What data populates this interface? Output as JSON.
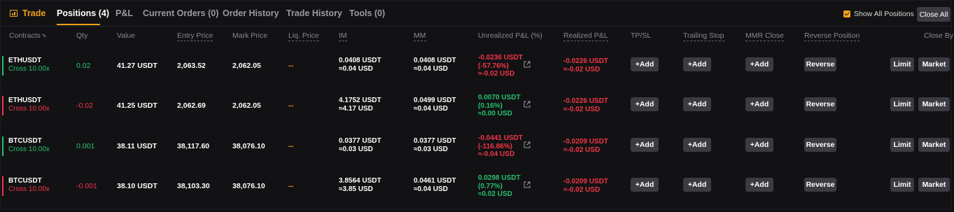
{
  "tabs": {
    "trade": "Trade",
    "positions": "Positions (4)",
    "pnl": "P&L",
    "current_orders": "Current Orders (0)",
    "order_history": "Order History",
    "trade_history": "Trade History",
    "tools": "Tools (0)"
  },
  "options": {
    "show_all_positions": "Show All Positions",
    "show_all_checked": true,
    "close_all": "Close All"
  },
  "columns": {
    "contracts": "Contracts",
    "qty": "Qty",
    "value": "Value",
    "entry_price": "Entry Price",
    "mark_price": "Mark Price",
    "liq_price": "Liq. Price",
    "im": "IM",
    "mm": "MM",
    "unrealized_pnl": "Unrealized P&L (%)",
    "realized_pnl": "Realized P&L",
    "tpsl": "TP/SL",
    "trailing_stop": "Trailing Stop",
    "mmr_close": "MMR Close",
    "reverse_position": "Reverse Position",
    "close_by": "Close By"
  },
  "buttons": {
    "add": "+Add",
    "reverse": "Reverse",
    "limit": "Limit",
    "market": "Market"
  },
  "colors": {
    "accent": "#f0a11a",
    "long": "#25c26b",
    "short": "#f23645"
  },
  "positions": [
    {
      "symbol": "ETHUSDT",
      "leverage": "Cross 10.00x",
      "side": "long",
      "qty": "0.02",
      "value": "41.27 USDT",
      "entry_price": "2,063.52",
      "mark_price": "2,062.05",
      "liq_price": "--",
      "im": "0.0408 USDT",
      "im_usd": "≈0.04 USD",
      "mm": "0.0408 USDT",
      "mm_usd": "≈0.04 USD",
      "upnl": "-0.0236 USDT",
      "upnl_pct": "(-57.76%)",
      "upnl_usd": "≈-0.02 USD",
      "upnl_sign": "negative",
      "rpnl": "-0.0226 USDT",
      "rpnl_usd": "≈-0.02 USD"
    },
    {
      "symbol": "ETHUSDT",
      "leverage": "Cross 10.00x",
      "side": "short",
      "qty": "-0.02",
      "value": "41.25 USDT",
      "entry_price": "2,062.69",
      "mark_price": "2,062.05",
      "liq_price": "--",
      "im": "4.1752 USDT",
      "im_usd": "≈4.17 USD",
      "mm": "0.0499 USDT",
      "mm_usd": "≈0.04 USD",
      "upnl": "0.0070 USDT",
      "upnl_pct": "(0.16%)",
      "upnl_usd": "≈0.00 USD",
      "upnl_sign": "positive",
      "rpnl": "-0.0226 USDT",
      "rpnl_usd": "≈-0.02 USD"
    },
    {
      "symbol": "BTCUSDT",
      "leverage": "Cross 10.00x",
      "side": "long",
      "qty": "0.001",
      "value": "38.11 USDT",
      "entry_price": "38,117.60",
      "mark_price": "38,076.10",
      "liq_price": "--",
      "im": "0.0377 USDT",
      "im_usd": "≈0.03 USD",
      "mm": "0.0377 USDT",
      "mm_usd": "≈0.03 USD",
      "upnl": "-0.0441 USDT",
      "upnl_pct": "(-116.86%)",
      "upnl_usd": "≈-0.04 USD",
      "upnl_sign": "negative",
      "rpnl": "-0.0209 USDT",
      "rpnl_usd": "≈-0.02 USD"
    },
    {
      "symbol": "BTCUSDT",
      "leverage": "Cross 10.00x",
      "side": "short",
      "qty": "-0.001",
      "value": "38.10 USDT",
      "entry_price": "38,103.30",
      "mark_price": "38,076.10",
      "liq_price": "--",
      "im": "3.8564 USDT",
      "im_usd": "≈3.85 USD",
      "mm": "0.0461 USDT",
      "mm_usd": "≈0.04 USD",
      "upnl": "0.0298 USDT",
      "upnl_pct": "(0.77%)",
      "upnl_usd": "≈0.02 USD",
      "upnl_sign": "positive",
      "rpnl": "-0.0209 USDT",
      "rpnl_usd": "≈-0.02 USD"
    }
  ]
}
